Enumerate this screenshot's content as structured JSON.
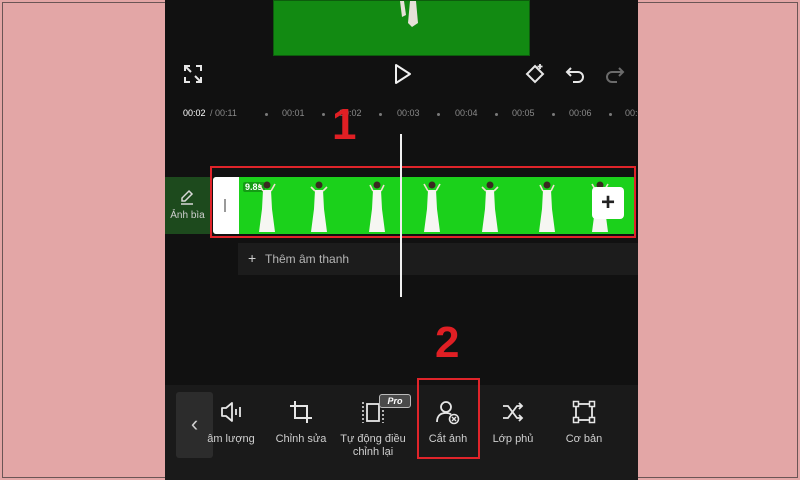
{
  "ruler": {
    "current_time": "00:02",
    "total_time": "/ 00:11",
    "ticks": [
      "00:01",
      "00:02",
      "00:03",
      "00:04",
      "00:05",
      "00:06",
      "00:0"
    ]
  },
  "timeline": {
    "cover_label": "Ảnh bìa",
    "clip_duration": "9.8s",
    "add_audio_label": "Thêm âm thanh"
  },
  "annotations": {
    "step1": "1",
    "step2": "2"
  },
  "bottom_toolbar": {
    "badge": "Pro",
    "items": [
      {
        "label": "âm lượng",
        "icon": "volume-icon"
      },
      {
        "label": "Chỉnh sửa",
        "icon": "crop-icon"
      },
      {
        "label": "Tự động điều chỉnh lại",
        "icon": "auto-reframe-icon"
      },
      {
        "label": "Cắt ảnh",
        "icon": "cutout-icon"
      },
      {
        "label": "Lớp phủ",
        "icon": "overlay-icon"
      },
      {
        "label": "Cơ bản",
        "icon": "basic-icon"
      }
    ]
  },
  "colors": {
    "background": "#e3a6a6",
    "green_screen": "#1bd11b",
    "highlight": "#e0242a",
    "app_bg": "#111111"
  }
}
